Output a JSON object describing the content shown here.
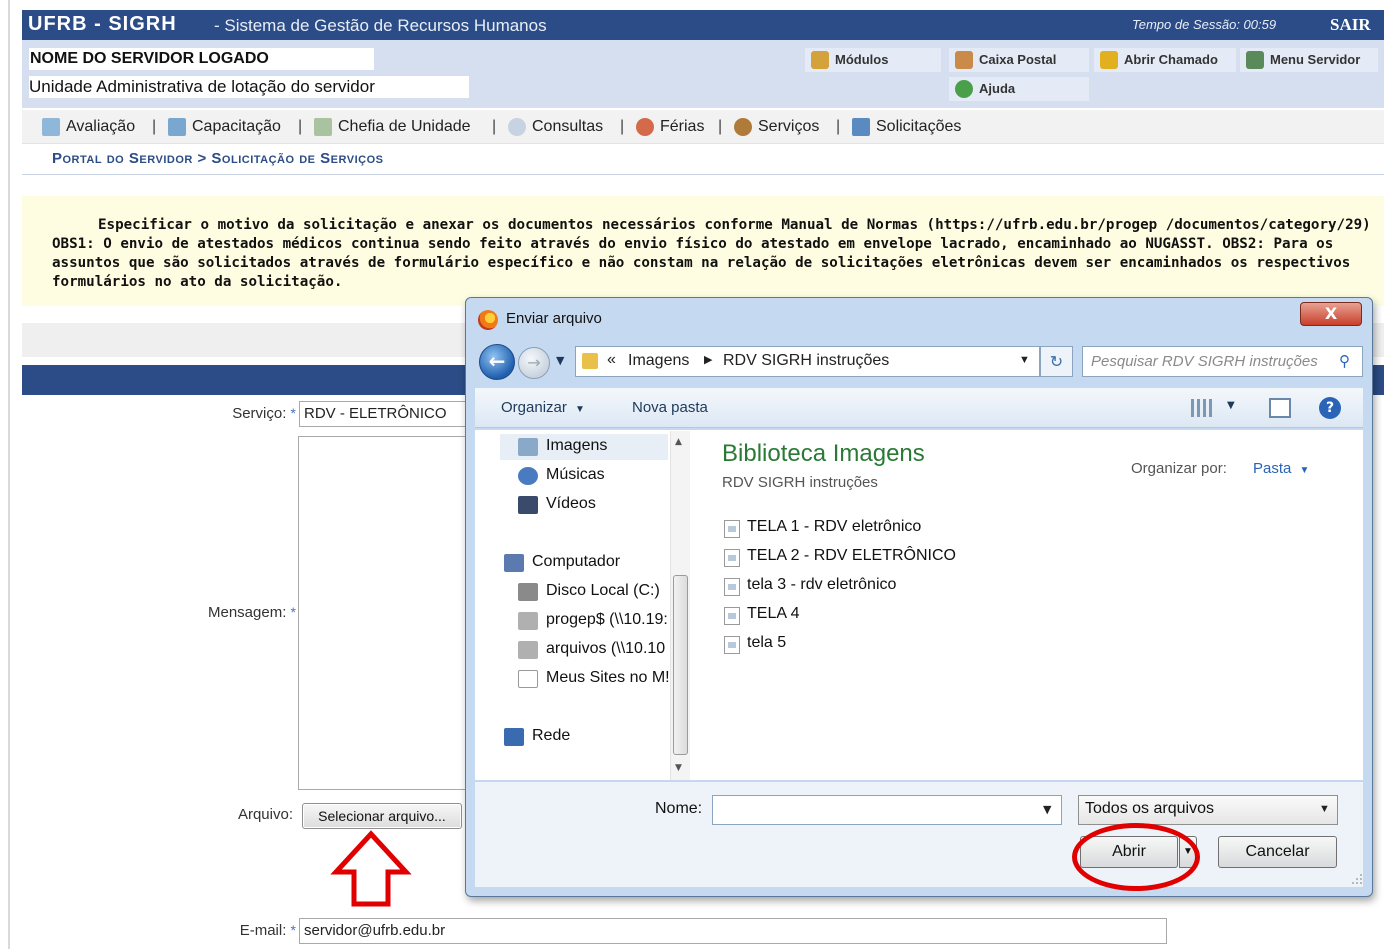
{
  "header": {
    "title": "UFRB - SIGRH",
    "subtitle": "- Sistema de Gestão de Recursos Humanos",
    "session_label": "Tempo de Sessão: 00:59",
    "exit_label": "SAIR"
  },
  "user": {
    "name": "NOME DO SERVIDOR LOGADO",
    "unit": "Unidade Administrativa de lotação do servidor"
  },
  "quick_links": {
    "modulos": "Módulos",
    "caixa_postal": "Caixa Postal",
    "abrir_chamado": "Abrir Chamado",
    "menu_servidor": "Menu Servidor",
    "ajuda": "Ajuda"
  },
  "menu": {
    "items": [
      "Avaliação",
      "Capacitação",
      "Chefia de Unidade",
      "Consultas",
      "Férias",
      "Serviços",
      "Solicitações"
    ],
    "separator": "|"
  },
  "breadcrumb": "Portal do Servidor > Solicitação de Serviços",
  "notice": "Especificar o motivo da solicitação e anexar os documentos necessários conforme Manual de Normas (https://ufrb.edu.br/progep /documentos/category/29) OBS1: O envio de atestados médicos continua sendo feito através do envio físico do atestado em envelope lacrado, encaminhado ao NUGASST. OBS2: Para os assuntos que são solicitados através de formulário específico e não constam na relação de solicitações eletrônicas devem ser encaminhados os respectivos formulários no ato da solicitação.",
  "form": {
    "servico_label": "Serviço:",
    "servico_value": "RDV - ELETRÔNICO",
    "mensagem_label": "Mensagem:",
    "arquivo_label": "Arquivo:",
    "select_file_button": "Selecionar arquivo...",
    "email_label": "E-mail:",
    "email_value": "servidor@ufrb.edu.br",
    "required_mark": "*"
  },
  "dialog": {
    "title": "Enviar arquivo",
    "close": "X",
    "path": [
      "Imagens",
      "RDV SIGRH instruções"
    ],
    "path_prefix": "«",
    "search_placeholder": "Pesquisar RDV SIGRH instruções",
    "toolbar": {
      "organize": "Organizar",
      "new_folder": "Nova pasta"
    },
    "tree": [
      "Imagens",
      "Músicas",
      "Vídeos",
      "Computador",
      "Disco Local (C:)",
      "progep$ (\\\\10.19:",
      "arquivos (\\\\10.10",
      "Meus Sites no M!",
      "Rede"
    ],
    "library_title": "Biblioteca Imagens",
    "library_subtitle": "RDV SIGRH instruções",
    "organize_by_label": "Organizar por:",
    "organize_by_value": "Pasta",
    "files": [
      "TELA 1 - RDV eletrônico",
      "TELA 2 - RDV ELETRÔNICO",
      "tela 3 - rdv eletrônico",
      "TELA 4",
      "tela 5"
    ],
    "name_label": "Nome:",
    "name_value": "",
    "type_filter": "Todos os arquivos",
    "open_button": "Abrir",
    "cancel_button": "Cancelar"
  },
  "annotations": {
    "arrow_color": "#e00000",
    "ellipse_color": "#e00000"
  },
  "colors": {
    "header_blue": "#2b4c86",
    "notice_bg": "#fffde1",
    "library_title_green": "#2a7a36"
  }
}
